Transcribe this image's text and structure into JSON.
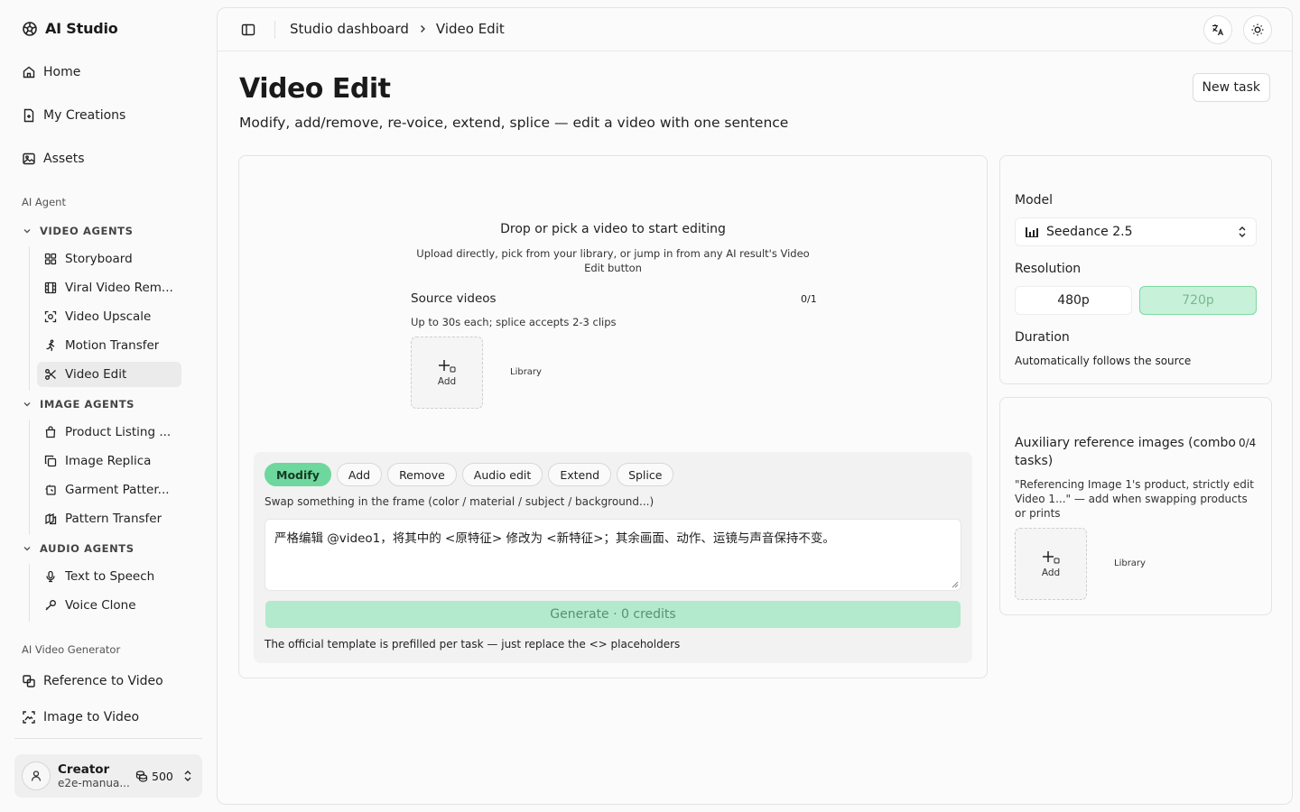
{
  "app": {
    "name": "AI Studio"
  },
  "sidebar": {
    "nav": [
      {
        "label": "Home",
        "icon": "home-icon"
      },
      {
        "label": "My Creations",
        "icon": "file-icon"
      },
      {
        "label": "Assets",
        "icon": "image-icon"
      }
    ],
    "ai_agent_label": "AI Agent",
    "video_agents": {
      "heading": "VIDEO AGENTS",
      "items": [
        {
          "label": "Storyboard",
          "icon": "grid-icon"
        },
        {
          "label": "Viral Video Rem...",
          "icon": "film-icon"
        },
        {
          "label": "Video Upscale",
          "icon": "upscale-icon"
        },
        {
          "label": "Motion Transfer",
          "icon": "running-figure-icon"
        },
        {
          "label": "Video Edit",
          "icon": "scissors-icon",
          "active": true
        }
      ]
    },
    "image_agents": {
      "heading": "IMAGE AGENTS",
      "items": [
        {
          "label": "Product Listing ...",
          "icon": "shopping-bag-icon"
        },
        {
          "label": "Image Replica",
          "icon": "copy-icon"
        },
        {
          "label": "Garment Patter...",
          "icon": "puzzle-icon"
        },
        {
          "label": "Pattern Transfer",
          "icon": "pattern-transfer-icon"
        }
      ]
    },
    "audio_agents": {
      "heading": "AUDIO AGENTS",
      "items": [
        {
          "label": "Text to Speech",
          "icon": "microphone-icon"
        },
        {
          "label": "Voice Clone",
          "icon": "voice-clone-icon"
        }
      ]
    },
    "generator_label": "AI Video Generator",
    "generator_items": [
      {
        "label": "Reference to Video",
        "icon": "reference-icon"
      },
      {
        "label": "Image to Video",
        "icon": "image-to-video-icon"
      }
    ],
    "user": {
      "name": "Creator",
      "email": "e2e-manua...",
      "credits": "500"
    }
  },
  "topbar": {
    "breadcrumb": [
      "Studio dashboard",
      "Video Edit"
    ]
  },
  "page": {
    "title": "Video Edit",
    "subtitle": "Modify, add/remove, re-voice, extend, splice — edit a video with one sentence",
    "new_task_label": "New task"
  },
  "editor": {
    "drop_title": "Drop or pick a video to start editing",
    "drop_desc": "Upload directly, pick from your library, or jump in from any AI result's Video Edit button",
    "source_label": "Source videos",
    "source_count": "0/1",
    "source_hint": "Up to 30s each; splice accepts 2-3 clips",
    "add_label": "Add",
    "library_label": "Library",
    "tasks": [
      "Modify",
      "Add",
      "Remove",
      "Audio edit",
      "Extend",
      "Splice"
    ],
    "active_task": "Modify",
    "task_desc": "Swap something in the frame (color / material / subject / background...)",
    "prompt_value": "严格编辑 @video1，将其中的 <原特征> 修改为 <新特征>；其余画面、动作、运镜与声音保持不变。",
    "generate_label": "Generate · 0 credits",
    "task_note": "The official template is prefilled per task — just replace the <> placeholders"
  },
  "settings": {
    "model_label": "Model",
    "model_value": "Seedance 2.5",
    "resolution_label": "Resolution",
    "resolutions": [
      "480p",
      "720p"
    ],
    "selected_resolution": "720p",
    "duration_label": "Duration",
    "duration_note": "Automatically follows the source"
  },
  "aux": {
    "title": "Auxiliary reference images (combo tasks)",
    "count": "0/4",
    "desc": "\"Referencing Image 1's product, strictly edit Video 1...\" — add when swapping products or prints",
    "add_label": "Add",
    "library_label": "Library"
  },
  "colors": {
    "accent": "#6ed79d",
    "generate_disabled": "#b3e9cd",
    "selected_res_bg": "#c8f1d9"
  }
}
